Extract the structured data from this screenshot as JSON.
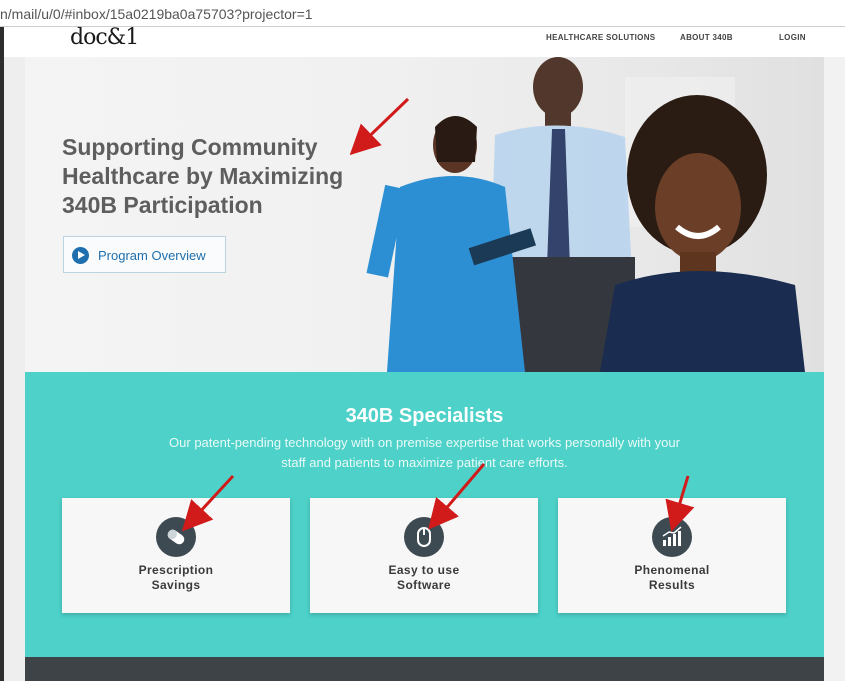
{
  "browser": {
    "url": "n/mail/u/0/#inbox/15a0219ba0a75703?projector=1"
  },
  "header": {
    "logo": "doc&1",
    "nav": [
      "HEALTHCARE SOLUTIONS",
      "ABOUT 340B",
      "LOGIN"
    ]
  },
  "hero": {
    "title_lines": [
      "Supporting Community",
      "Healthcare by Maximizing",
      "340B Participation"
    ],
    "button_label": "Program Overview"
  },
  "specialists": {
    "title": "340B Specialists",
    "subtitle_lines": [
      "Our patent-pending technology with on premise expertise that works personally with your",
      "staff and patients to maximize patient care efforts."
    ],
    "cards": [
      {
        "label": "Prescription\nSavings",
        "icon": "pill-icon"
      },
      {
        "label": "Easy to use\nSoftware",
        "icon": "mouse-icon"
      },
      {
        "label": "Phenomenal\nResults",
        "icon": "growth-chart-icon"
      }
    ]
  },
  "colors": {
    "teal": "#4dd1c8",
    "annotation_arrow": "#d11a1a",
    "brand_blue": "#1f6fae",
    "icon_bg": "#3e4a52",
    "footer": "#3e4347"
  }
}
